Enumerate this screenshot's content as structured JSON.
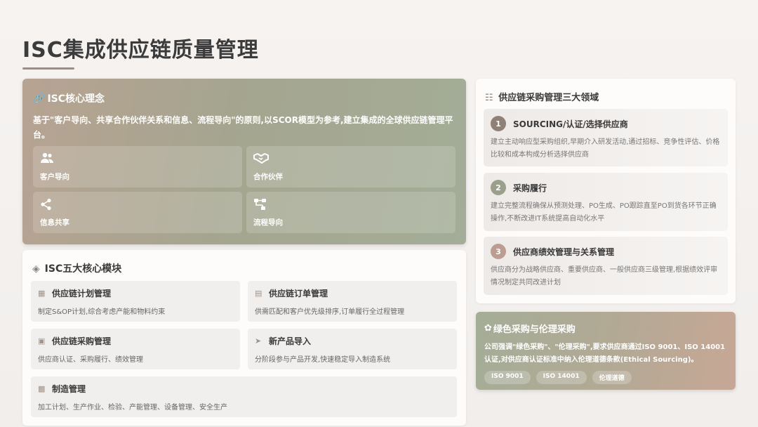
{
  "page": {
    "title": "ISC集成供应链质量管理"
  },
  "core": {
    "icon": "link-icon",
    "heading": "ISC核心理念",
    "description": "基于\"客户导向、共享合作伙伴关系和信息、流程导向\"的原则,以SCOR模型为参考,建立集成的全球供应链管理平台。",
    "items": [
      {
        "icon": "users-icon",
        "label": "客户导向"
      },
      {
        "icon": "handshake-icon",
        "label": "合作伙伴"
      },
      {
        "icon": "share-icon",
        "label": "信息共享"
      },
      {
        "icon": "flow-icon",
        "label": "流程导向"
      }
    ]
  },
  "modules": {
    "icon": "cubes-icon",
    "heading": "ISC五大核心模块",
    "items": [
      {
        "icon": "calendar-icon",
        "title": "供应链计划管理",
        "desc": "制定S&OP计划,综合考虑产能和物料约束"
      },
      {
        "icon": "clipboard-icon",
        "title": "供应链订单管理",
        "desc": "供需匹配和客户优先级排序,订单履行全过程管理"
      },
      {
        "icon": "cart-icon",
        "title": "供应链采购管理",
        "desc": "供应商认证、采购履行、绩效管理"
      },
      {
        "icon": "rocket-icon",
        "title": "新产品导入",
        "desc": "分阶段参与产品开发,快速稳定导入制造系统"
      },
      {
        "icon": "factory-icon",
        "title": "制造管理",
        "desc": "加工计划、生产作业、检验、产能管理、设备管理、安全生产"
      }
    ]
  },
  "domains": {
    "icon": "sitemap-icon",
    "heading": "供应链采购管理三大领域",
    "items": [
      {
        "num": "1",
        "color": "#8f8178",
        "title": "SOURCING/认证/选择供应商",
        "desc": "建立主动响应型采购组织,早期介入研发活动,通过招标、竞争性评估、价格比较和成本构成分析选择供应商"
      },
      {
        "num": "2",
        "color": "#9aa08c",
        "title": "采购履行",
        "desc": "建立完整流程确保从预测处理、PO生成、PO跟踪直至PO到货各环节正确操作,不断改进IT系统提高自动化水平"
      },
      {
        "num": "3",
        "color": "#bb9e8f",
        "title": "供应商绩效管理与关系管理",
        "desc": "供应商分为战略供应商、重要供应商、一般供应商三级管理,根据绩效评审情况制定共同改进计划"
      }
    ]
  },
  "green": {
    "icon": "leaf-icon",
    "heading": "绿色采购与伦理采购",
    "description": "公司强调\"绿色采购\"、\"伦理采购\",要求供应商通过ISO 9001、ISO 14001认证,对供应商认证标准中纳入伦理道德条款(Ethical Sourcing)。",
    "tags": [
      "ISO 9001",
      "ISO 14001",
      "伦理道德"
    ]
  }
}
